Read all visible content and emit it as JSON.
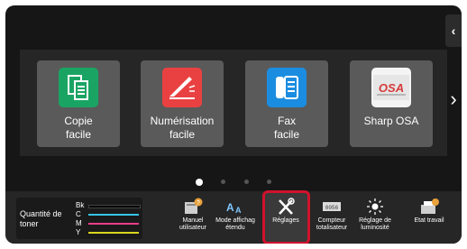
{
  "tiles": [
    {
      "label": "Copie\nfacile",
      "icon": "copy-icon",
      "color": "#1aa463"
    },
    {
      "label": "Numérisation\nfacile",
      "icon": "scan-icon",
      "color": "#e94141"
    },
    {
      "label": "Fax\nfacile",
      "icon": "fax-icon",
      "color": "#1b8de0"
    },
    {
      "label": "Sharp OSA",
      "icon": "osa-icon",
      "color": "#ffffff"
    }
  ],
  "toner": {
    "label": "Quantité de toner",
    "channels": [
      {
        "name": "Bk",
        "color": "#000000"
      },
      {
        "name": "C",
        "color": "#36c3e6"
      },
      {
        "name": "M",
        "color": "#e83e8c"
      },
      {
        "name": "Y",
        "color": "#d9d61e"
      }
    ]
  },
  "tools": [
    {
      "label": "Manuel\nutilisateur",
      "icon": "manual-icon"
    },
    {
      "label": "Mode affichag\nétendu",
      "icon": "text-size-icon"
    },
    {
      "label": "Réglages",
      "icon": "settings-tools-icon"
    },
    {
      "label": "Compteur\ntotalisateur",
      "icon": "counter-icon"
    },
    {
      "label": "Réglage de\nluminosité",
      "icon": "brightness-icon"
    },
    {
      "label": "Etat travail",
      "icon": "job-status-icon"
    }
  ],
  "page_dots": {
    "count": 4,
    "active": 1
  },
  "colors": {
    "accent_highlight": "#d0122c",
    "screen_bg": "#161616"
  }
}
